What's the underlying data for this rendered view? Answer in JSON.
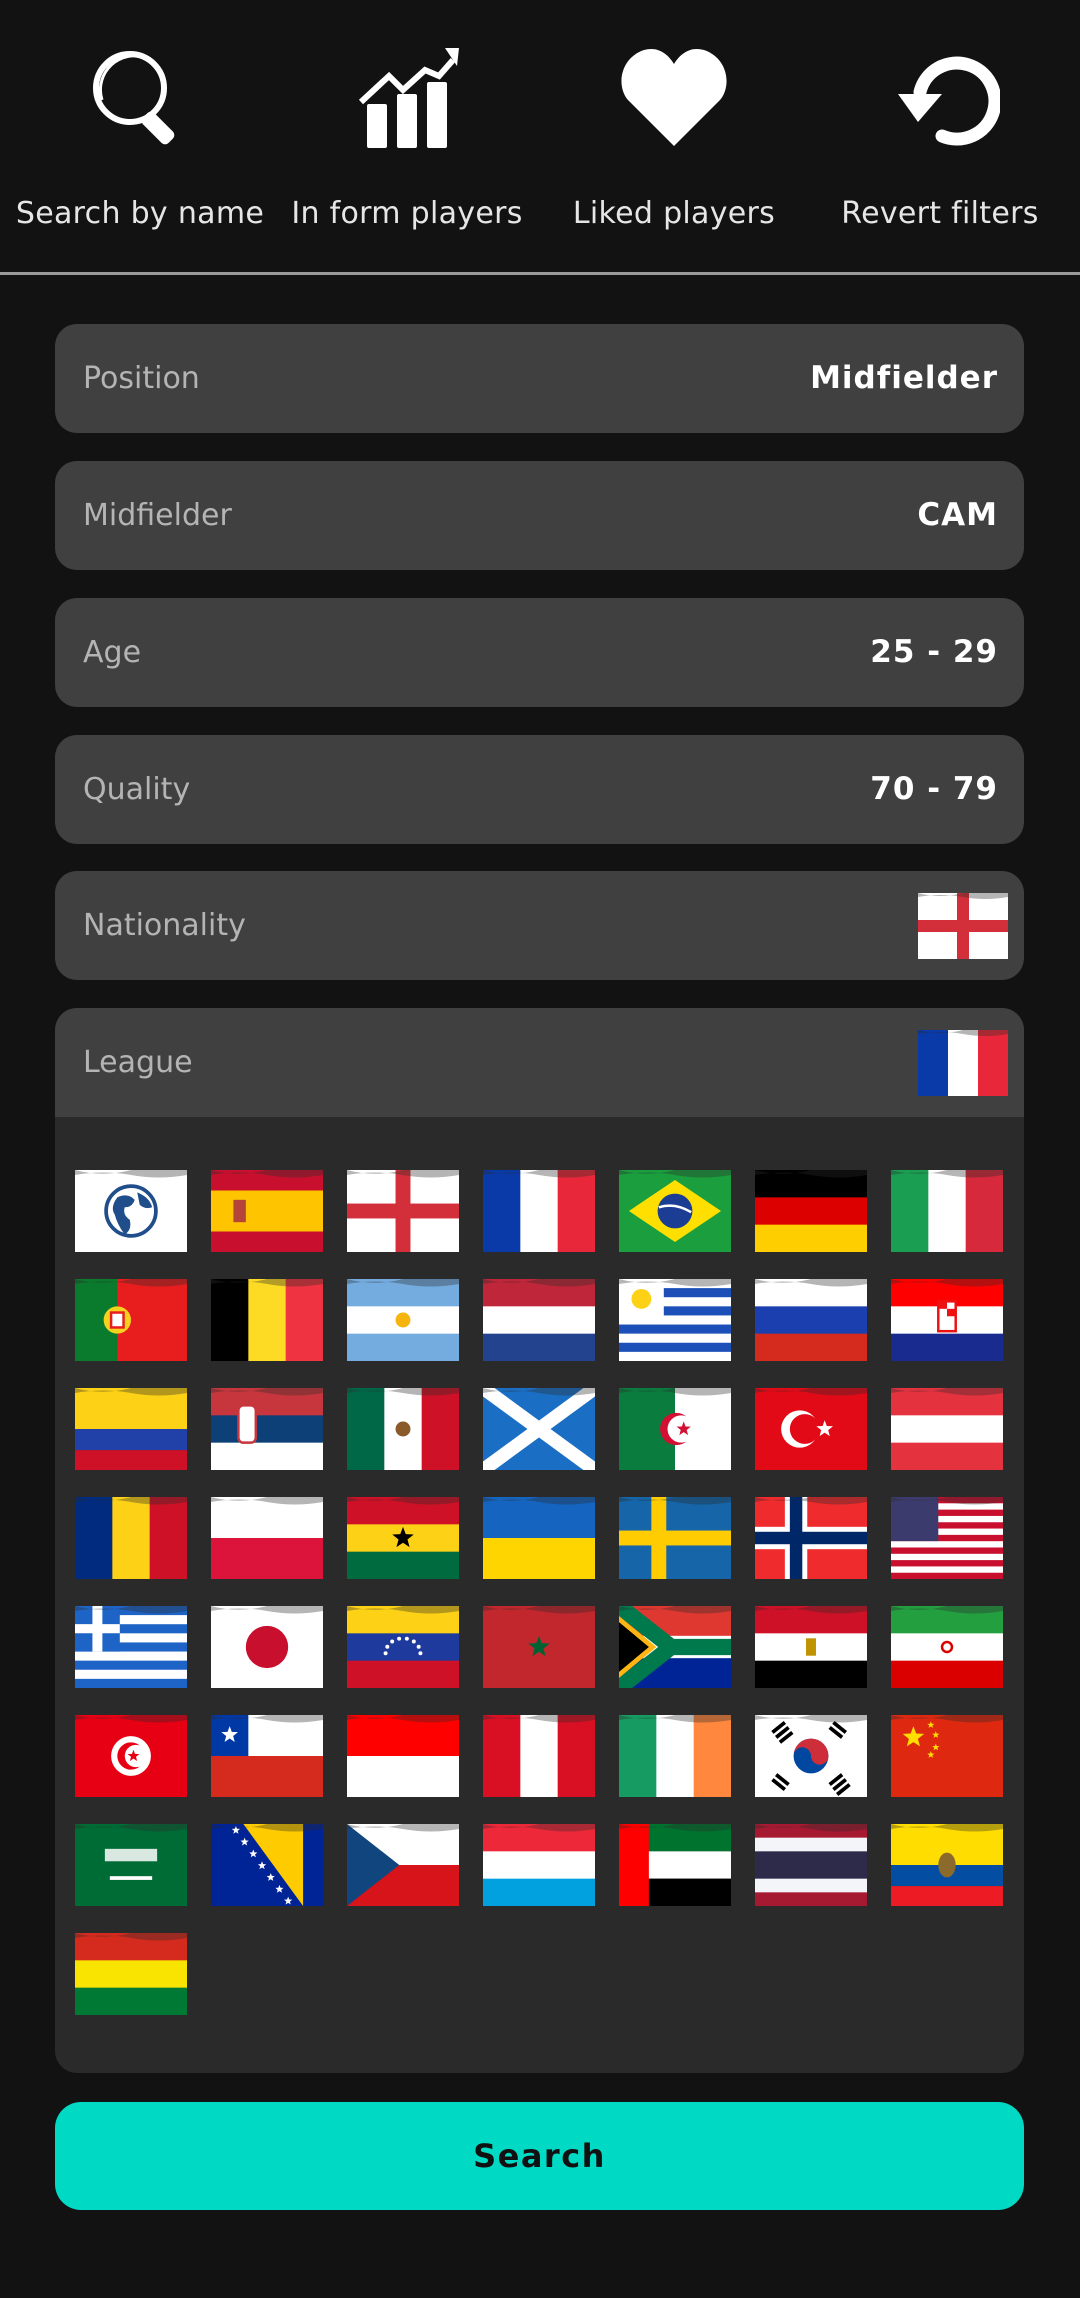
{
  "toolbar": {
    "items": [
      {
        "label": "Search by name",
        "icon": "magnifier-icon"
      },
      {
        "label": "In form players",
        "icon": "trending-chart-icon"
      },
      {
        "label": "Liked players",
        "icon": "heart-icon"
      },
      {
        "label": "Revert filters",
        "icon": "revert-icon"
      }
    ]
  },
  "filters": {
    "position": {
      "label": "Position",
      "value": "Midfielder"
    },
    "subposition": {
      "label": "Midfielder",
      "value": "CAM"
    },
    "age": {
      "label": "Age",
      "value": "25 - 29"
    },
    "quality": {
      "label": "Quality",
      "value": "70 - 79"
    },
    "nationality": {
      "label": "Nationality",
      "value": "England",
      "flag": "england"
    },
    "league": {
      "label": "League",
      "value": "France",
      "flag": "france"
    }
  },
  "league_options": [
    "world",
    "spain",
    "england",
    "france",
    "brazil",
    "germany",
    "italy",
    "portugal",
    "belgium",
    "argentina",
    "netherlands",
    "uruguay",
    "russia",
    "croatia",
    "colombia",
    "serbia",
    "mexico",
    "scotland",
    "algeria",
    "turkey",
    "austria",
    "romania",
    "poland",
    "ghana",
    "ukraine",
    "sweden",
    "norway",
    "usa",
    "greece",
    "japan",
    "venezuela",
    "morocco",
    "south-africa",
    "egypt",
    "iran",
    "tunisia",
    "chile",
    "indonesia",
    "peru",
    "ireland",
    "south-korea",
    "china",
    "saudi-arabia",
    "bosnia",
    "czechia",
    "luxembourg",
    "uae",
    "thailand",
    "ecuador",
    "bolivia"
  ],
  "colors": {
    "accent": "#00d9c4",
    "background": "#121212",
    "row": "#404040",
    "panel": "#2a2a2a"
  },
  "search": {
    "label": "Search"
  }
}
